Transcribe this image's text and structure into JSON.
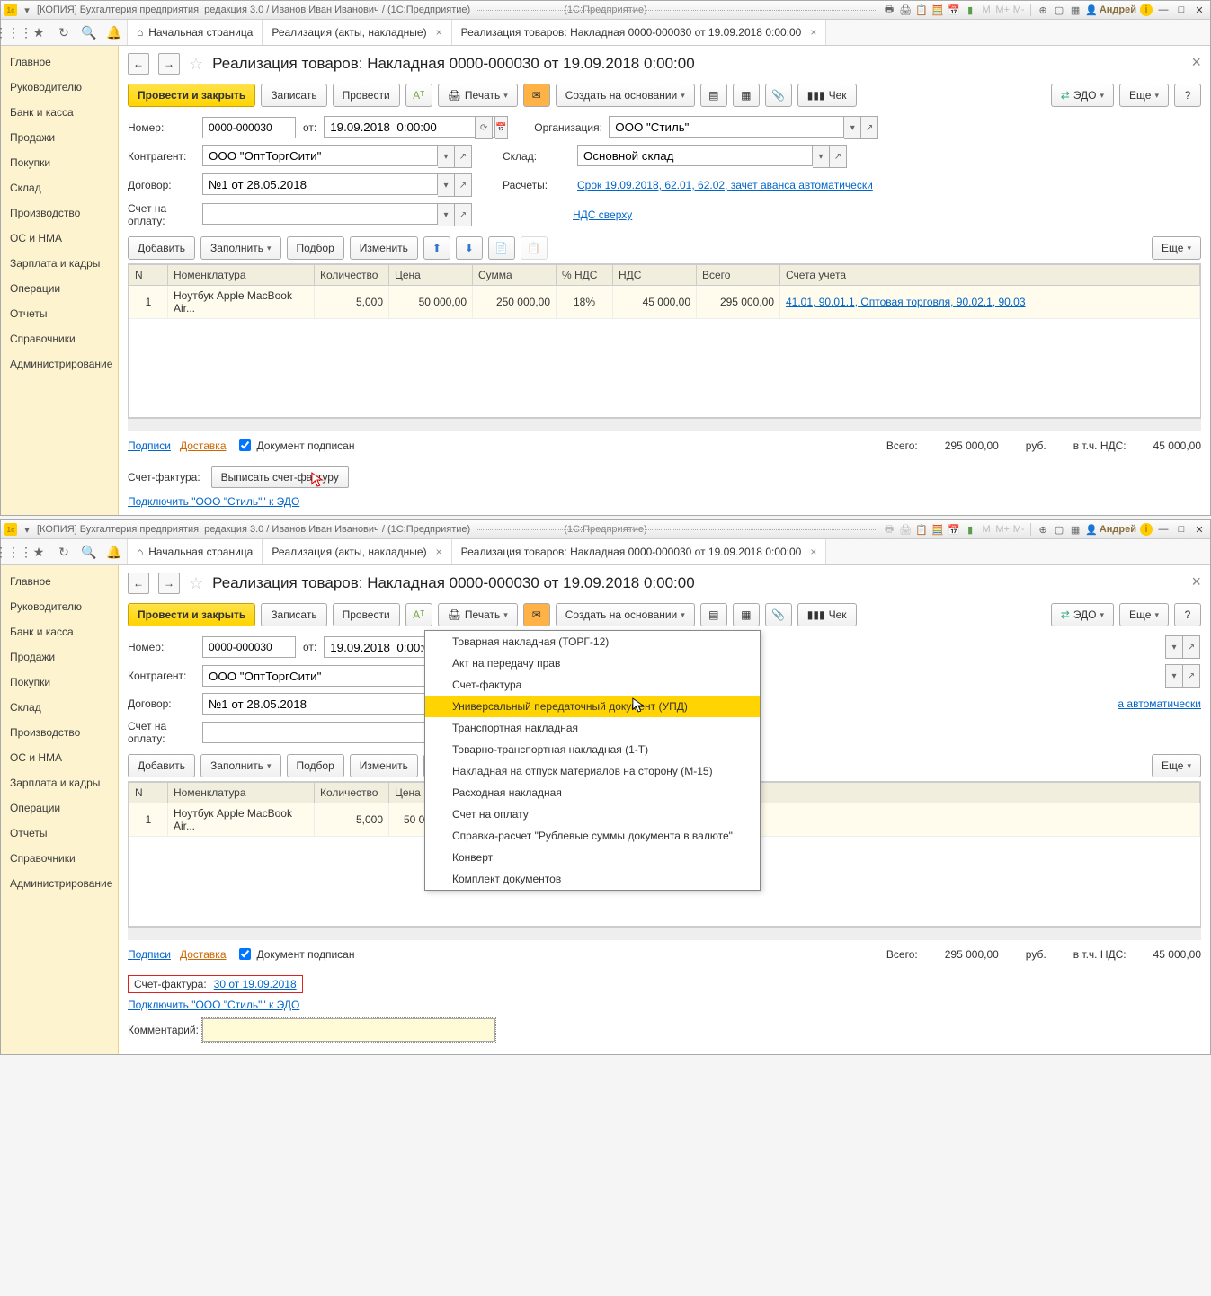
{
  "common": {
    "title_app": "[КОПИЯ] Бухгалтерия предприятия, редакция 3.0 / Иванов Иван Иванович / (1С:Предприятие)",
    "title_center": "(1С:Предприятие)",
    "user": "Андрей",
    "tabs": {
      "home": "Начальная страница",
      "t1": "Реализация (акты, накладные)",
      "t2": "Реализация товаров: Накладная 0000-000030 от 19.09.2018 0:00:00"
    },
    "sidebar": [
      "Главное",
      "Руководителю",
      "Банк и касса",
      "Продажи",
      "Покупки",
      "Склад",
      "Производство",
      "ОС и НМА",
      "Зарплата и кадры",
      "Операции",
      "Отчеты",
      "Справочники",
      "Администрирование"
    ],
    "doc_title": "Реализация товаров: Накладная 0000-000030 от 19.09.2018 0:00:00",
    "toolbar": {
      "post_close": "Провести и закрыть",
      "write": "Записать",
      "post": "Провести",
      "print": "Печать",
      "create_on": "Создать на основании",
      "chek": "Чек",
      "edo": "ЭДО",
      "more": "Еще"
    },
    "labels": {
      "number": "Номер:",
      "from": "от:",
      "org": "Организация:",
      "contr": "Контрагент:",
      "sklad": "Склад:",
      "dogovor": "Договор:",
      "raschety": "Расчеты:",
      "schet": "Счет на оплату:",
      "prod": "Продажи",
      "comment": "Комментарий:"
    },
    "values": {
      "number": "0000-000030",
      "date": "19.09.2018  0:00:00",
      "org": "ООО \"Стиль\"",
      "contr": "ООО \"ОптТоргСити\"",
      "sklad": "Основной склад",
      "dogovor": "№1 от 28.05.2018",
      "raschety_link": "Срок 19.09.2018, 62.01, 62.02, зачет аванса автоматически",
      "nds_link": "НДС сверху"
    },
    "tbl_toolbar": {
      "add": "Добавить",
      "fill": "Заполнить",
      "pick": "Подбор",
      "change": "Изменить",
      "more": "Еще"
    },
    "grid_headers": {
      "n": "N",
      "nom": "Номенклатура",
      "qty": "Количество",
      "price": "Цена",
      "sum": "Сумма",
      "pnds": "% НДС",
      "nds": "НДС",
      "total": "Всего",
      "accts": "Счета учета"
    },
    "grid_row": {
      "n": "1",
      "nom": "Ноутбук Apple MacBook Air...",
      "qty": "5,000",
      "price": "50 000,00",
      "sum": "250 000,00",
      "pnds": "18%",
      "nds": "45 000,00",
      "total": "295 000,00",
      "accts": "41.01, 90.01.1, Оптовая торговля, 90.02.1, 90.03"
    },
    "totals": {
      "podpisi": "Подписи",
      "dostavka": "Доставка",
      "signed": "Документ подписан",
      "total_lbl": "Всего:",
      "total_val": "295 000,00",
      "rub": "руб.",
      "incl": "в т.ч. НДС:",
      "nds_val": "45 000,00"
    },
    "edo_link": "Подключить \"ООО \"Стиль\"\" к ЭДО"
  },
  "pane1": {
    "sf_label": "Счет-фактура:",
    "sf_btn": "Выписать счет-фактуру"
  },
  "pane2": {
    "sf_label": "Счет-фактура:",
    "sf_link": "30 от 19.09.2018",
    "dropdown": [
      "Товарная накладная (ТОРГ-12)",
      "Акт на передачу прав",
      "Счет-фактура",
      "Универсальный передаточный документ (УПД)",
      "Транспортная накладная",
      "Товарно-транспортная накладная (1-Т)",
      "Накладная на отпуск материалов на сторону (М-15)",
      "Расходная накладная",
      "Счет на оплату",
      "Справка-расчет \"Рублевые суммы документа в валюте\"",
      "Конверт",
      "Комплект документов"
    ],
    "dropdown_hl_index": 3
  }
}
